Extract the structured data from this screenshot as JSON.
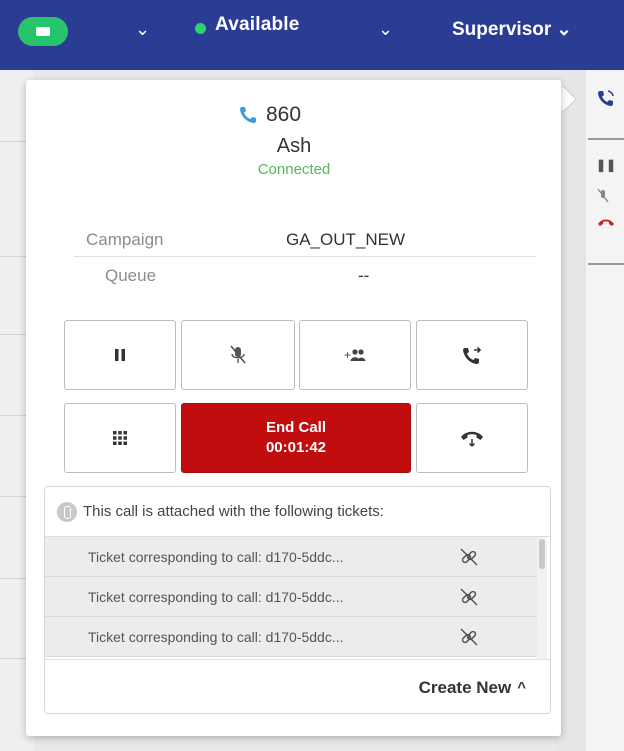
{
  "topbar": {
    "status_label": "Available",
    "role_label": "Supervisor",
    "colors": {
      "bar": "#2b3c94",
      "pill": "#27c46b",
      "status_dot": "#2ed46a"
    }
  },
  "call": {
    "number": "860",
    "name": "Ash",
    "state": "Connected"
  },
  "details": {
    "campaign_label": "Campaign",
    "campaign_value": "GA_OUT_NEW",
    "queue_label": "Queue",
    "queue_value": "--"
  },
  "controls": {
    "end_call_label": "End Call",
    "end_call_timer": "00:01:42",
    "icons": [
      "pause-icon",
      "mute-icon",
      "add-participant-icon",
      "transfer-call-icon",
      "dialpad-icon",
      "hold-phone-icon"
    ]
  },
  "tickets": {
    "header": "This call is attached with the following tickets:",
    "rows": [
      "Ticket corresponding to call: d170-5ddc...",
      "Ticket corresponding to call: d170-5ddc...",
      "Ticket corresponding to call: d170-5ddc..."
    ],
    "create_label": "Create New"
  }
}
